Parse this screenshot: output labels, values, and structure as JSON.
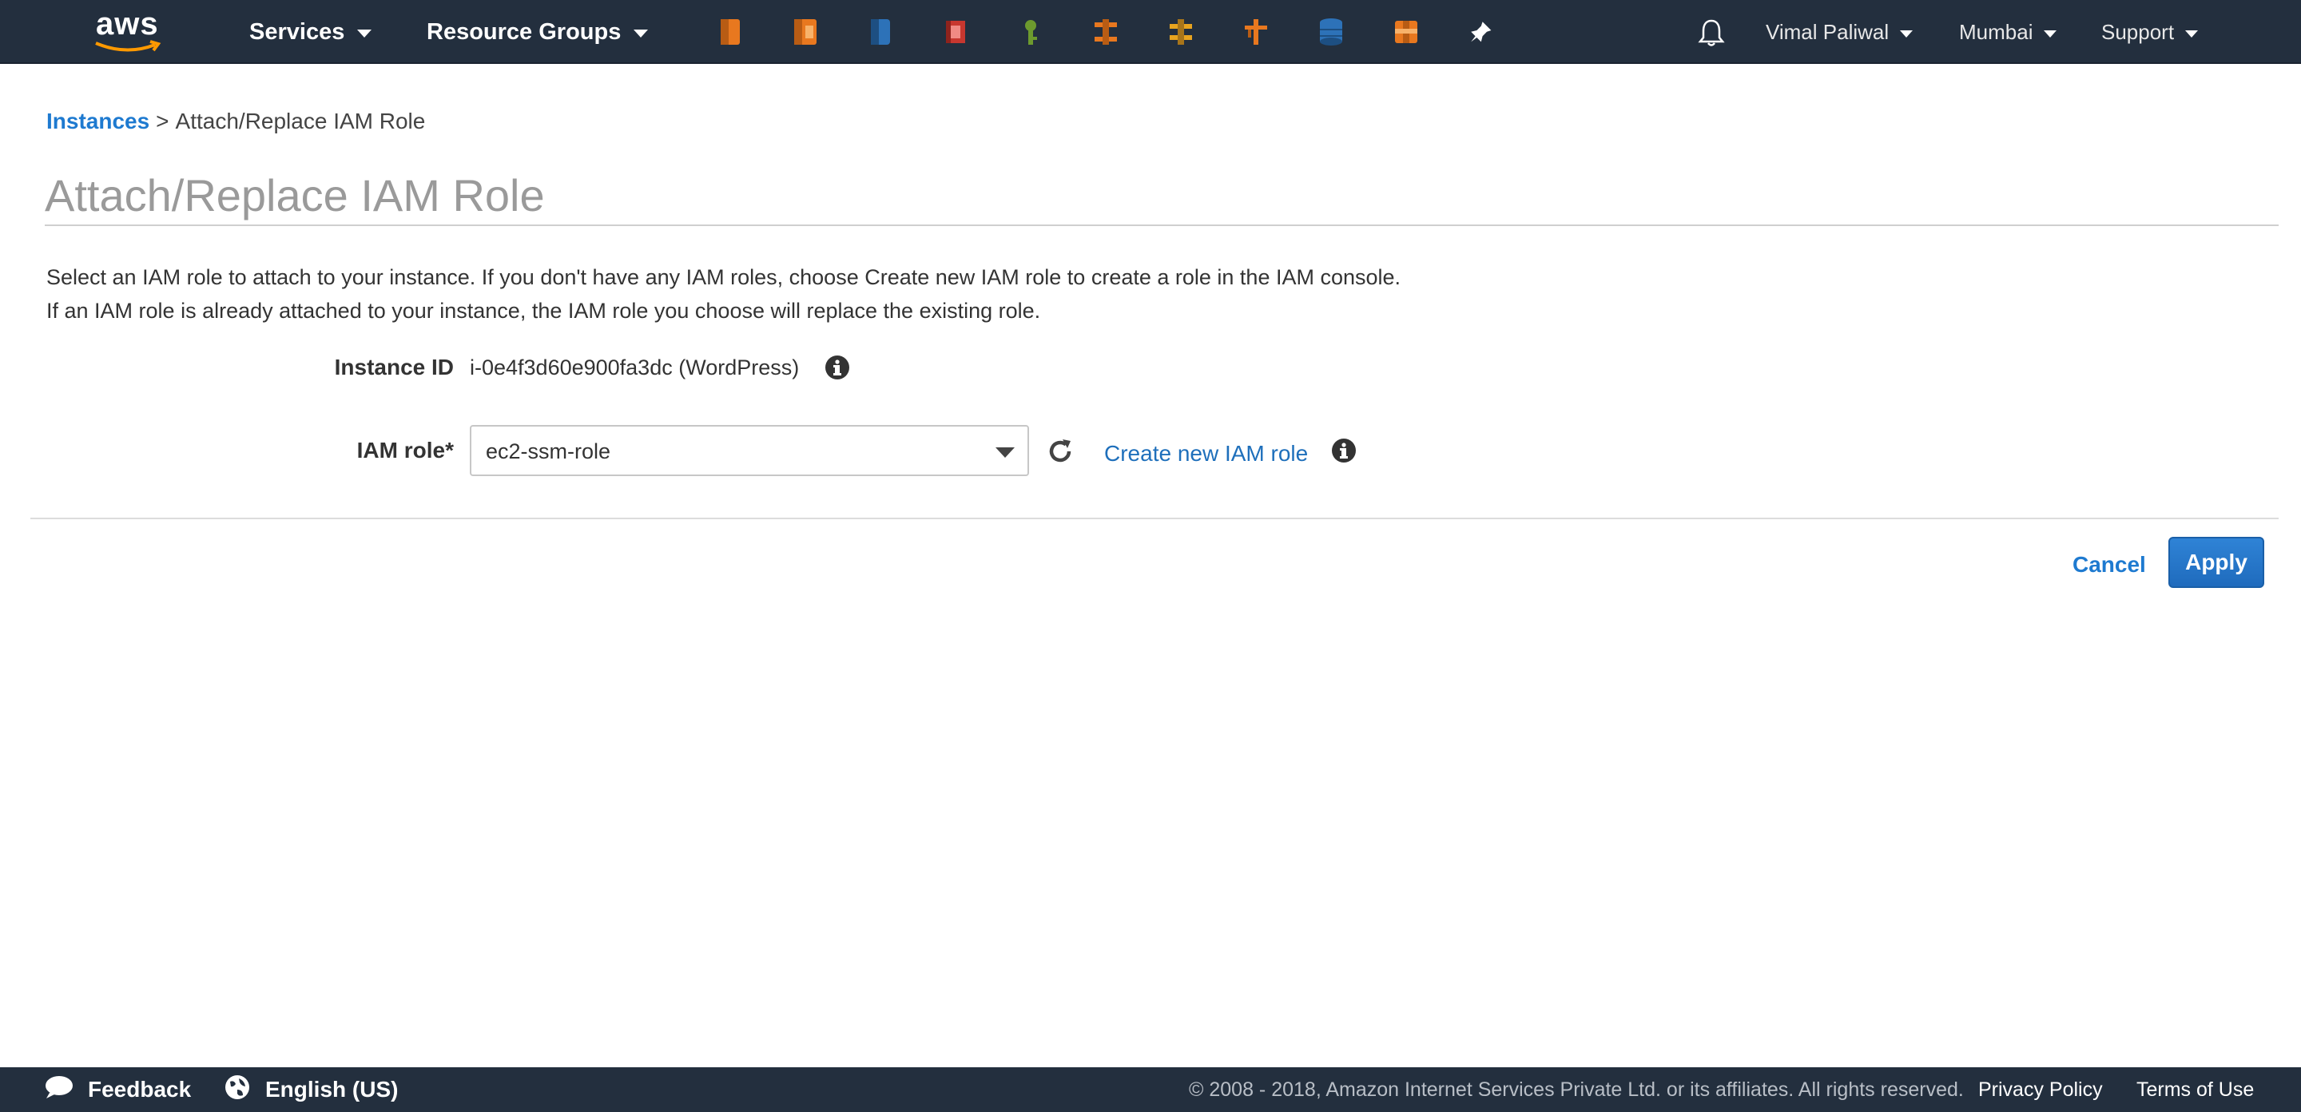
{
  "topnav": {
    "logo_text": "aws",
    "services_label": "Services",
    "resource_groups_label": "Resource Groups",
    "shortcuts": [
      {
        "icon": "ec2-icon",
        "color": "#e8781f"
      },
      {
        "icon": "elastic-beanstalk-icon",
        "color": "#e8781f"
      },
      {
        "icon": "rds-icon",
        "color": "#2d72b8"
      },
      {
        "icon": "codedeploy-icon",
        "color": "#c7372f"
      },
      {
        "icon": "iam-key-icon",
        "color": "#6d9a2e"
      },
      {
        "icon": "cloudfront-icon",
        "color": "#e8781f"
      },
      {
        "icon": "route53-icon",
        "color": "#e8a41f"
      },
      {
        "icon": "lambda-icon",
        "color": "#e8781f"
      },
      {
        "icon": "dynamodb-icon",
        "color": "#2d72b8"
      },
      {
        "icon": "vpc-icon",
        "color": "#e8781f"
      }
    ],
    "user_label": "Vimal Paliwal",
    "region_label": "Mumbai",
    "support_label": "Support"
  },
  "breadcrumb": {
    "parent": "Instances",
    "separator": ">",
    "current": "Attach/Replace IAM Role"
  },
  "page_title": "Attach/Replace IAM Role",
  "description": {
    "line1": "Select an IAM role to attach to your instance. If you don't have any IAM roles, choose Create new IAM role to create a role in the IAM console.",
    "line2": "If an IAM role is already attached to your instance, the IAM role you choose will replace the existing role."
  },
  "form": {
    "instance_id_label": "Instance ID",
    "instance_id_value": "i-0e4f3d60e900fa3dc (WordPress)",
    "iam_role_label": "IAM role*",
    "iam_role_value": "ec2-ssm-role",
    "create_role_link": "Create new IAM role"
  },
  "actions": {
    "cancel_label": "Cancel",
    "apply_label": "Apply"
  },
  "footer": {
    "feedback_label": "Feedback",
    "language_label": "English (US)",
    "copyright": "© 2008 - 2018, Amazon Internet Services Private Ltd. or its affiliates. All rights reserved.",
    "privacy_label": "Privacy Policy",
    "terms_label": "Terms of Use"
  },
  "colors": {
    "nav_bg": "#232f3e",
    "link": "#1e7ad0",
    "primary_button": "#1f6bbd",
    "title_gray": "#9a9a9a"
  }
}
